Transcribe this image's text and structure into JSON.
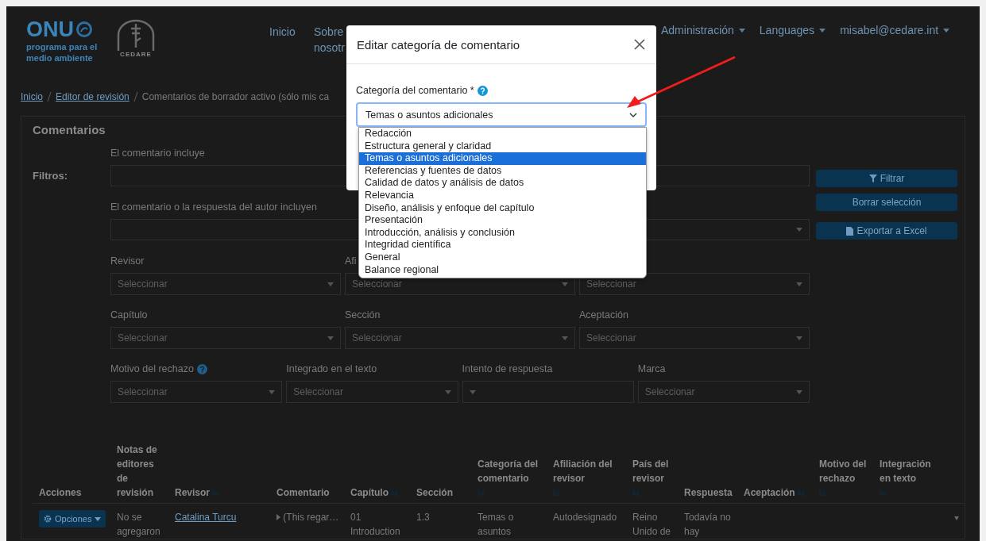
{
  "header": {
    "logo": {
      "title": "ONU",
      "subtitle": "programa para el medio ambiente"
    },
    "emblem": {
      "label": "CEDARE"
    },
    "nav": [
      {
        "label": "Inicio"
      },
      {
        "label": "Sobre nosotr"
      }
    ],
    "menus": [
      {
        "label": "Administración",
        "kind": "admin"
      },
      {
        "label": "Languages",
        "kind": "plain"
      },
      {
        "label": "misabel@cedare.int",
        "kind": "plain"
      }
    ]
  },
  "breadcrumb": [
    {
      "label": "Inicio",
      "link": true
    },
    {
      "label": "Editor de revisión",
      "link": true
    },
    {
      "label": "Comentarios de borrador activo (sólo mis ca",
      "link": false
    }
  ],
  "card_title": "Comentarios",
  "filters": {
    "title": "Filtros:",
    "text_fields": [
      {
        "label": "El comentario incluye",
        "dropdown": false
      },
      {
        "label": "El comentario o la respuesta del autor incluyen",
        "dropdown": true
      }
    ],
    "rows": [
      {
        "fields": [
          {
            "label": "Revisor",
            "placeholder": "Seleccionar"
          },
          {
            "label": "Afi",
            "placeholder": "Seleccionar"
          },
          {
            "placeholder": "Seleccionar"
          }
        ]
      },
      {
        "fields": [
          {
            "label": "Capítulo",
            "placeholder": "Seleccionar"
          },
          {
            "label": "Sección",
            "placeholder": "Seleccionar"
          },
          {
            "label": "Aceptación",
            "placeholder": "Seleccionar"
          }
        ]
      },
      {
        "fields": [
          {
            "label": "Motivo del rechazo",
            "help": true,
            "placeholder": "Seleccionar"
          },
          {
            "label": "Integrado en el texto",
            "placeholder": "Seleccionar"
          },
          {
            "label": "Intento de respuesta"
          },
          {
            "label": "Marca",
            "placeholder": "Seleccionar"
          }
        ]
      }
    ],
    "buttons": [
      {
        "label": "Filtrar",
        "kind": "filter"
      },
      {
        "label": "Borrar selección",
        "kind": "plain"
      },
      {
        "label": "Exportar a Excel",
        "kind": "file"
      }
    ]
  },
  "table": {
    "columns": [
      {
        "label": "Acciones",
        "kind": "plain"
      },
      {
        "label": "Notas de editores de revisión",
        "kind": "plain"
      },
      {
        "label": "Revisor",
        "kind": "sortable"
      },
      {
        "label": "Comentario",
        "kind": "plain"
      },
      {
        "label": "Capítulo",
        "kind": "sortable"
      },
      {
        "label": "Sección",
        "kind": "plain"
      },
      {
        "label": "Categoría del comentario",
        "kind": "sortable"
      },
      {
        "label": "Afiliación del revisor",
        "kind": "sortable"
      },
      {
        "label": "País del revisor",
        "kind": "sortable"
      },
      {
        "label": "Respuesta",
        "kind": "plain"
      },
      {
        "label": "Aceptación",
        "kind": "sortable"
      },
      {
        "label": "Motivo del rechazo",
        "kind": "sortable"
      },
      {
        "label": "Integración en texto",
        "kind": "sortable"
      }
    ],
    "rows": [
      {
        "cells": [
          {
            "kind": "button",
            "text": "Opciones"
          },
          {
            "kind": "text",
            "text": "No se agregaron"
          },
          {
            "kind": "link",
            "text": "Catalina Turcu"
          },
          {
            "kind": "expander",
            "text": "(This regar…"
          },
          {
            "kind": "text",
            "text": "01 Introduction"
          },
          {
            "kind": "text",
            "text": "1.3"
          },
          {
            "kind": "text",
            "text": "Temas o asuntos"
          },
          {
            "kind": "text",
            "text": "Autodesignado"
          },
          {
            "kind": "text",
            "text": "Reino Unido de"
          },
          {
            "kind": "text",
            "text": "Todavía no hay"
          },
          {
            "kind": "text",
            "text": ""
          },
          {
            "kind": "text",
            "text": ""
          },
          {
            "kind": "text",
            "text": ""
          },
          {
            "kind": "toggle"
          }
        ]
      }
    ]
  },
  "modal": {
    "title": "Editar categoría de comentario",
    "field": {
      "label": "Categoría del comentario *",
      "help": true,
      "value": "Temas o asuntos adicionales",
      "options": [
        {
          "label": "Redacción",
          "selected": false
        },
        {
          "label": "Estructura general y claridad",
          "selected": false
        },
        {
          "label": "Temas o asuntos adicionales",
          "selected": true
        },
        {
          "label": "Referencias y fuentes de datos",
          "selected": false
        },
        {
          "label": "Calidad de datos y análisis de datos",
          "selected": false
        },
        {
          "label": "Relevancia",
          "selected": false
        },
        {
          "label": "Diseño, análisis y enfoque del capítulo",
          "selected": false
        },
        {
          "label": "Presentación",
          "selected": false
        },
        {
          "label": "Introducción, análisis y conclusión",
          "selected": false
        },
        {
          "label": "Integridad científica",
          "selected": false
        },
        {
          "label": "General",
          "selected": false
        },
        {
          "label": "Balance regional",
          "selected": false
        }
      ]
    }
  }
}
